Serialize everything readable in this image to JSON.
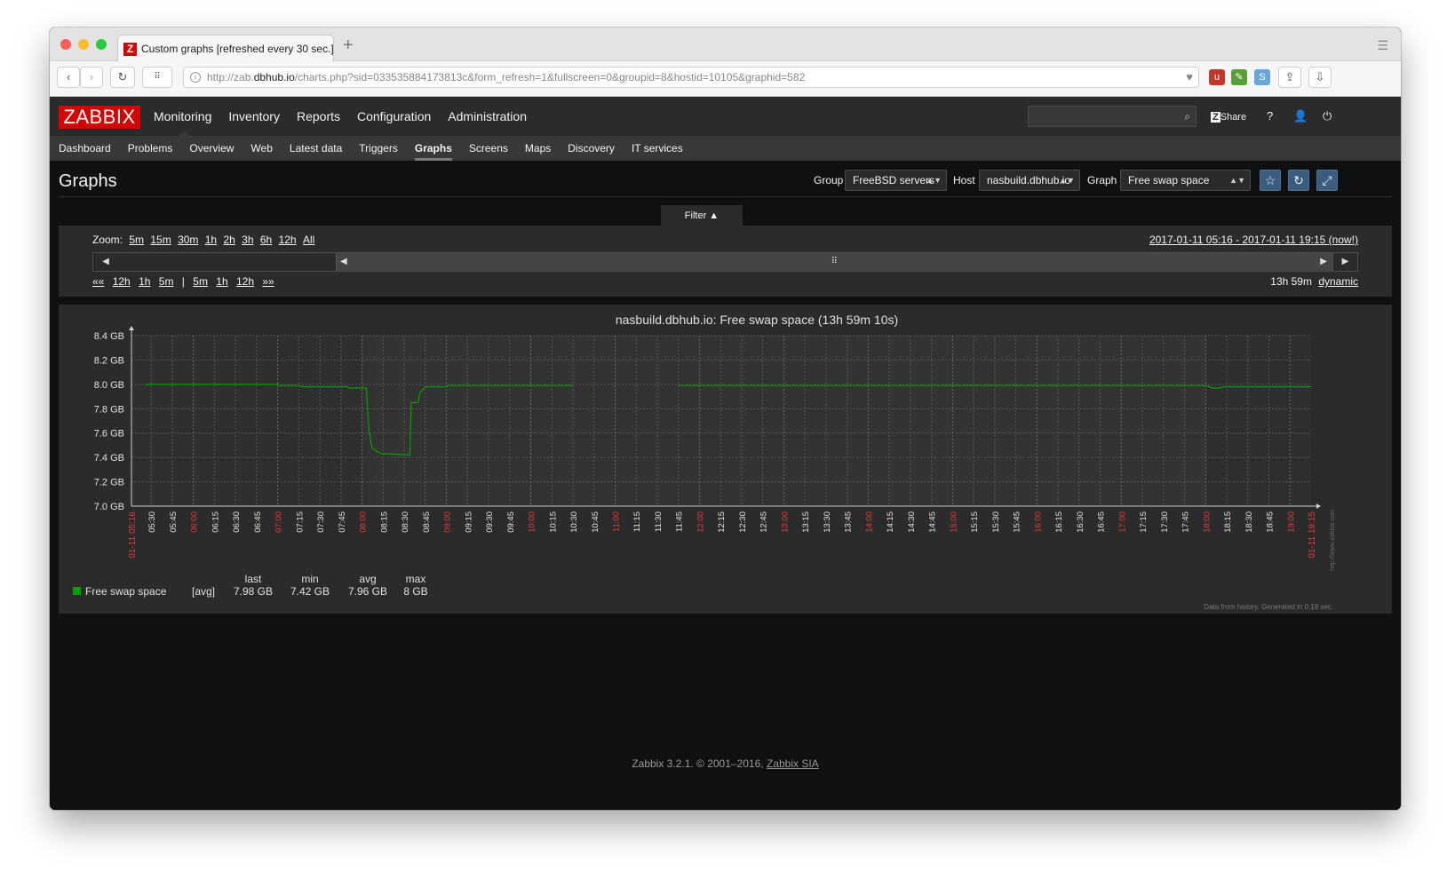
{
  "browser": {
    "tab_title": "Custom graphs [refreshed every 30 sec.]",
    "new_tab": "+",
    "url_prefix": "http://zab.",
    "url_host": "dbhub.io",
    "url_rest": "/charts.php?sid=033535884173813c&form_refresh=1&fullscreen=0&groupid=8&hostid=10105&graphid=582"
  },
  "header": {
    "logo": "ZABBIX",
    "menu": [
      {
        "label": "Monitoring",
        "selected": true
      },
      {
        "label": "Inventory"
      },
      {
        "label": "Reports"
      },
      {
        "label": "Configuration"
      },
      {
        "label": "Administration"
      }
    ],
    "share_label": "Share",
    "help_label": "?"
  },
  "submenu": [
    {
      "label": "Dashboard"
    },
    {
      "label": "Problems"
    },
    {
      "label": "Overview"
    },
    {
      "label": "Web"
    },
    {
      "label": "Latest data"
    },
    {
      "label": "Triggers"
    },
    {
      "label": "Graphs",
      "selected": true
    },
    {
      "label": "Screens"
    },
    {
      "label": "Maps"
    },
    {
      "label": "Discovery"
    },
    {
      "label": "IT services"
    }
  ],
  "page": {
    "title": "Graphs",
    "group_label": "Group",
    "group_value": "FreeBSD servers",
    "host_label": "Host",
    "host_value": "nasbuild.dbhub.io",
    "graph_label": "Graph",
    "graph_value": "Free swap space"
  },
  "filter": {
    "tab_label": "Filter ▲",
    "zoom_label": "Zoom:",
    "zoom_options": [
      "5m",
      "15m",
      "30m",
      "1h",
      "2h",
      "3h",
      "6h",
      "12h",
      "All"
    ],
    "range_text": "2017-01-11 05:16 - 2017-01-11 19:15 (now!)",
    "nav_back": "««",
    "nav_left": [
      "12h",
      "1h",
      "5m"
    ],
    "nav_sep": "|",
    "nav_right": [
      "5m",
      "1h",
      "12h"
    ],
    "nav_forward": "»»",
    "period_value": "13h 59m",
    "period_mode": "dynamic"
  },
  "chart_data": {
    "type": "line",
    "title": "nasbuild.dbhub.io: Free swap space (13h 59m 10s)",
    "ylabel": "",
    "y_unit": "GB",
    "ylim": [
      7.0,
      8.4
    ],
    "y_ticks": [
      "7.0 GB",
      "7.2 GB",
      "7.4 GB",
      "7.6 GB",
      "7.8 GB",
      "8.0 GB",
      "8.2 GB",
      "8.4 GB"
    ],
    "x_start_label": "01-11 05:16",
    "x_end_label": "01-11 19:15",
    "x_ticks": [
      "05:30",
      "05:45",
      "06:00",
      "06:15",
      "06:30",
      "06:45",
      "07:00",
      "07:15",
      "07:30",
      "07:45",
      "08:00",
      "08:15",
      "08:30",
      "08:45",
      "09:00",
      "09:15",
      "09:30",
      "09:45",
      "10:00",
      "10:15",
      "10:30",
      "10:45",
      "11:00",
      "11:15",
      "11:30",
      "11:45",
      "12:00",
      "12:15",
      "12:30",
      "12:45",
      "13:00",
      "13:15",
      "13:30",
      "13:45",
      "14:00",
      "14:15",
      "14:30",
      "14:45",
      "15:00",
      "15:15",
      "15:30",
      "15:45",
      "16:00",
      "16:15",
      "16:30",
      "16:45",
      "17:00",
      "17:15",
      "17:30",
      "17:45",
      "18:00",
      "18:15",
      "18:30",
      "18:45",
      "19:00"
    ],
    "grid": true,
    "side_text": "http://www.zabbix.com",
    "series": [
      {
        "name": "Free swap space",
        "color": "#00a000",
        "segments": [
          [
            [
              "05:26",
              8.0
            ],
            [
              "07:00",
              8.0
            ],
            [
              "07:01",
              7.99
            ],
            [
              "07:16",
              7.99
            ],
            [
              "07:17",
              7.98
            ],
            [
              "07:50",
              7.98
            ],
            [
              "07:51",
              7.97
            ],
            [
              "08:03",
              7.97
            ],
            [
              "08:05",
              7.62
            ],
            [
              "08:07",
              7.48
            ],
            [
              "08:12",
              7.44
            ],
            [
              "08:14",
              7.43
            ],
            [
              "08:17",
              7.43
            ],
            [
              "08:34",
              7.42
            ],
            [
              "08:35",
              7.85
            ],
            [
              "08:40",
              7.85
            ],
            [
              "08:41",
              7.93
            ],
            [
              "08:45",
              7.98
            ],
            [
              "09:00",
              7.98
            ],
            [
              "09:01",
              7.99
            ],
            [
              "10:30",
              7.99
            ]
          ],
          [
            [
              "11:45",
              7.99
            ],
            [
              "18:00",
              7.99
            ],
            [
              "18:05",
              7.97
            ],
            [
              "18:10",
              7.97
            ],
            [
              "18:13",
              7.98
            ],
            [
              "19:15",
              7.98
            ]
          ]
        ]
      }
    ],
    "legend": {
      "headers": [
        "last",
        "min",
        "avg",
        "max"
      ],
      "rows": [
        {
          "name": "Free swap space",
          "func": "[avg]",
          "last": "7.98 GB",
          "min": "7.42 GB",
          "avg": "7.96 GB",
          "max": "8 GB"
        }
      ]
    },
    "footnote": "Data from history. Generated in 0.19 sec."
  },
  "footer": {
    "text": "Zabbix 3.2.1. © 2001–2016,",
    "link": "Zabbix SIA"
  }
}
